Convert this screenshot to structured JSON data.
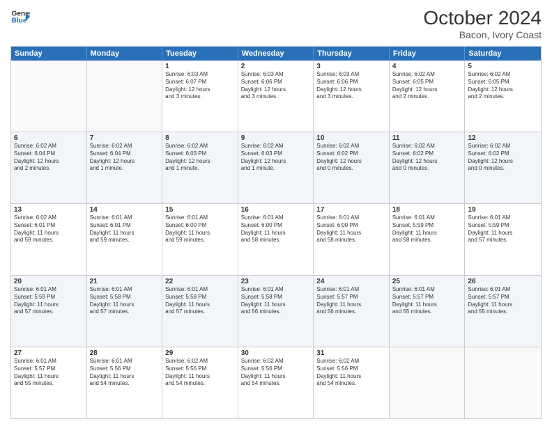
{
  "logo": {
    "line1": "General",
    "line2": "Blue",
    "icon": "▶"
  },
  "title": "October 2024",
  "subtitle": "Bacon, Ivory Coast",
  "headers": [
    "Sunday",
    "Monday",
    "Tuesday",
    "Wednesday",
    "Thursday",
    "Friday",
    "Saturday"
  ],
  "weeks": [
    [
      {
        "date": "",
        "info": ""
      },
      {
        "date": "",
        "info": ""
      },
      {
        "date": "1",
        "info": "Sunrise: 6:03 AM\nSunset: 6:07 PM\nDaylight: 12 hours\nand 3 minutes."
      },
      {
        "date": "2",
        "info": "Sunrise: 6:03 AM\nSunset: 6:06 PM\nDaylight: 12 hours\nand 3 minutes."
      },
      {
        "date": "3",
        "info": "Sunrise: 6:03 AM\nSunset: 6:06 PM\nDaylight: 12 hours\nand 3 minutes."
      },
      {
        "date": "4",
        "info": "Sunrise: 6:02 AM\nSunset: 6:05 PM\nDaylight: 12 hours\nand 2 minutes."
      },
      {
        "date": "5",
        "info": "Sunrise: 6:02 AM\nSunset: 6:05 PM\nDaylight: 12 hours\nand 2 minutes."
      }
    ],
    [
      {
        "date": "6",
        "info": "Sunrise: 6:02 AM\nSunset: 6:04 PM\nDaylight: 12 hours\nand 2 minutes."
      },
      {
        "date": "7",
        "info": "Sunrise: 6:02 AM\nSunset: 6:04 PM\nDaylight: 12 hours\nand 1 minute."
      },
      {
        "date": "8",
        "info": "Sunrise: 6:02 AM\nSunset: 6:03 PM\nDaylight: 12 hours\nand 1 minute."
      },
      {
        "date": "9",
        "info": "Sunrise: 6:02 AM\nSunset: 6:03 PM\nDaylight: 12 hours\nand 1 minute."
      },
      {
        "date": "10",
        "info": "Sunrise: 6:02 AM\nSunset: 6:02 PM\nDaylight: 12 hours\nand 0 minutes."
      },
      {
        "date": "11",
        "info": "Sunrise: 6:02 AM\nSunset: 6:02 PM\nDaylight: 12 hours\nand 0 minutes."
      },
      {
        "date": "12",
        "info": "Sunrise: 6:02 AM\nSunset: 6:02 PM\nDaylight: 12 hours\nand 0 minutes."
      }
    ],
    [
      {
        "date": "13",
        "info": "Sunrise: 6:02 AM\nSunset: 6:01 PM\nDaylight: 11 hours\nand 59 minutes."
      },
      {
        "date": "14",
        "info": "Sunrise: 6:01 AM\nSunset: 6:01 PM\nDaylight: 11 hours\nand 59 minutes."
      },
      {
        "date": "15",
        "info": "Sunrise: 6:01 AM\nSunset: 6:00 PM\nDaylight: 11 hours\nand 59 minutes."
      },
      {
        "date": "16",
        "info": "Sunrise: 6:01 AM\nSunset: 6:00 PM\nDaylight: 11 hours\nand 58 minutes."
      },
      {
        "date": "17",
        "info": "Sunrise: 6:01 AM\nSunset: 6:00 PM\nDaylight: 11 hours\nand 58 minutes."
      },
      {
        "date": "18",
        "info": "Sunrise: 6:01 AM\nSunset: 5:59 PM\nDaylight: 11 hours\nand 58 minutes."
      },
      {
        "date": "19",
        "info": "Sunrise: 6:01 AM\nSunset: 5:59 PM\nDaylight: 11 hours\nand 57 minutes."
      }
    ],
    [
      {
        "date": "20",
        "info": "Sunrise: 6:01 AM\nSunset: 5:59 PM\nDaylight: 11 hours\nand 57 minutes."
      },
      {
        "date": "21",
        "info": "Sunrise: 6:01 AM\nSunset: 5:58 PM\nDaylight: 11 hours\nand 57 minutes."
      },
      {
        "date": "22",
        "info": "Sunrise: 6:01 AM\nSunset: 5:58 PM\nDaylight: 11 hours\nand 57 minutes."
      },
      {
        "date": "23",
        "info": "Sunrise: 6:01 AM\nSunset: 5:58 PM\nDaylight: 11 hours\nand 56 minutes."
      },
      {
        "date": "24",
        "info": "Sunrise: 6:01 AM\nSunset: 5:57 PM\nDaylight: 11 hours\nand 56 minutes."
      },
      {
        "date": "25",
        "info": "Sunrise: 6:01 AM\nSunset: 5:57 PM\nDaylight: 11 hours\nand 55 minutes."
      },
      {
        "date": "26",
        "info": "Sunrise: 6:01 AM\nSunset: 5:57 PM\nDaylight: 11 hours\nand 55 minutes."
      }
    ],
    [
      {
        "date": "27",
        "info": "Sunrise: 6:01 AM\nSunset: 5:57 PM\nDaylight: 11 hours\nand 55 minutes."
      },
      {
        "date": "28",
        "info": "Sunrise: 6:01 AM\nSunset: 5:56 PM\nDaylight: 11 hours\nand 54 minutes."
      },
      {
        "date": "29",
        "info": "Sunrise: 6:02 AM\nSunset: 5:56 PM\nDaylight: 11 hours\nand 54 minutes."
      },
      {
        "date": "30",
        "info": "Sunrise: 6:02 AM\nSunset: 5:56 PM\nDaylight: 11 hours\nand 54 minutes."
      },
      {
        "date": "31",
        "info": "Sunrise: 6:02 AM\nSunset: 5:56 PM\nDaylight: 11 hours\nand 54 minutes."
      },
      {
        "date": "",
        "info": ""
      },
      {
        "date": "",
        "info": ""
      }
    ]
  ]
}
